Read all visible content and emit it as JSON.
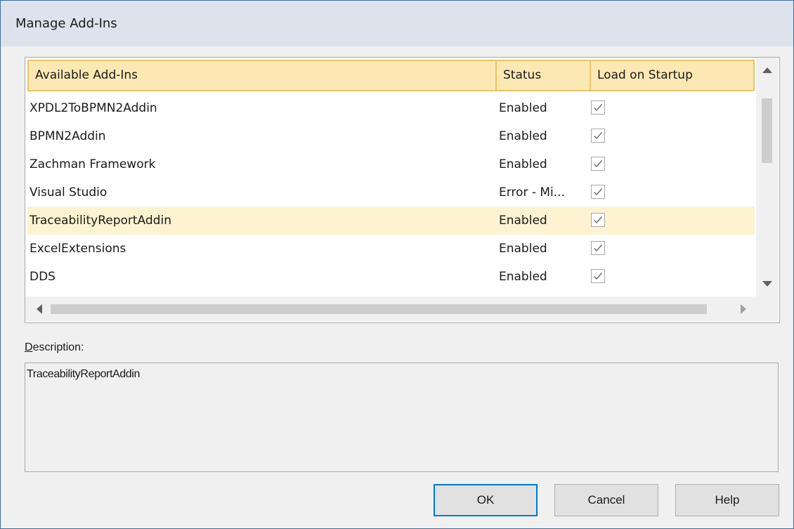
{
  "window": {
    "title": "Manage Add-Ins"
  },
  "list": {
    "columns": [
      "Available Add-Ins",
      "Status",
      "Load on Startup"
    ],
    "rows": [
      {
        "name": "XPDL2ToBPMN2Addin",
        "status": "Enabled",
        "load_on_startup": true,
        "selected": false
      },
      {
        "name": "BPMN2Addin",
        "status": "Enabled",
        "load_on_startup": true,
        "selected": false
      },
      {
        "name": "Zachman Framework",
        "status": "Enabled",
        "load_on_startup": true,
        "selected": false
      },
      {
        "name": "Visual Studio",
        "status": "Error - Mi...",
        "load_on_startup": true,
        "selected": false
      },
      {
        "name": "TraceabilityReportAddin",
        "status": "Enabled",
        "load_on_startup": true,
        "selected": true
      },
      {
        "name": "ExcelExtensions",
        "status": "Enabled",
        "load_on_startup": true,
        "selected": false
      },
      {
        "name": "DDS",
        "status": "Enabled",
        "load_on_startup": true,
        "selected": false
      }
    ]
  },
  "description": {
    "label_underlined": "D",
    "label_rest": "escription:",
    "text": "TraceabilityReportAddin"
  },
  "buttons": {
    "ok": "OK",
    "cancel": "Cancel",
    "help": "Help"
  },
  "colors": {
    "header_background": "#fce8b3",
    "header_border": "#e9c46a",
    "selected_row": "#fdf3d0",
    "title_bar": "#dce3ec",
    "focus_border": "#0078d7"
  },
  "icons": {
    "scroll_up": "triangle-up-icon",
    "scroll_down": "triangle-down-icon",
    "scroll_left": "triangle-left-icon",
    "scroll_right": "triangle-right-icon",
    "checkmark": "checkmark-icon"
  }
}
